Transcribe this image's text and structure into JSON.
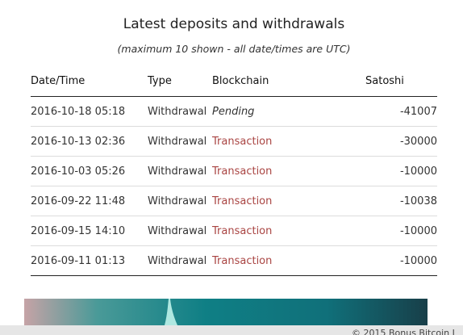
{
  "history": {
    "title": "Latest deposits and withdrawals",
    "subtitle": "(maximum 10 shown - all date/times are UTC)",
    "columns": {
      "date": "Date/Time",
      "type": "Type",
      "chain": "Blockchain",
      "satoshi": "Satoshi"
    },
    "rows": [
      {
        "date": "2016-10-18 05:18",
        "type": "Withdrawal",
        "chain": "Pending",
        "satoshi": "-41007"
      },
      {
        "date": "2016-10-13 02:36",
        "type": "Withdrawal",
        "chain": "Transaction",
        "satoshi": "-30000"
      },
      {
        "date": "2016-10-03 05:26",
        "type": "Withdrawal",
        "chain": "Transaction",
        "satoshi": "-10000"
      },
      {
        "date": "2016-09-22 11:48",
        "type": "Withdrawal",
        "chain": "Transaction",
        "satoshi": "-10038"
      },
      {
        "date": "2016-09-15 14:10",
        "type": "Withdrawal",
        "chain": "Transaction",
        "satoshi": "-10000"
      },
      {
        "date": "2016-09-11 01:13",
        "type": "Withdrawal",
        "chain": "Transaction",
        "satoshi": "-10000"
      }
    ]
  },
  "footer": {
    "copyright": "© 2015 Bonus Bitcoin L"
  },
  "colors": {
    "link": "#a94442",
    "rule": "#222222",
    "row_divider": "#dcdcdc"
  }
}
